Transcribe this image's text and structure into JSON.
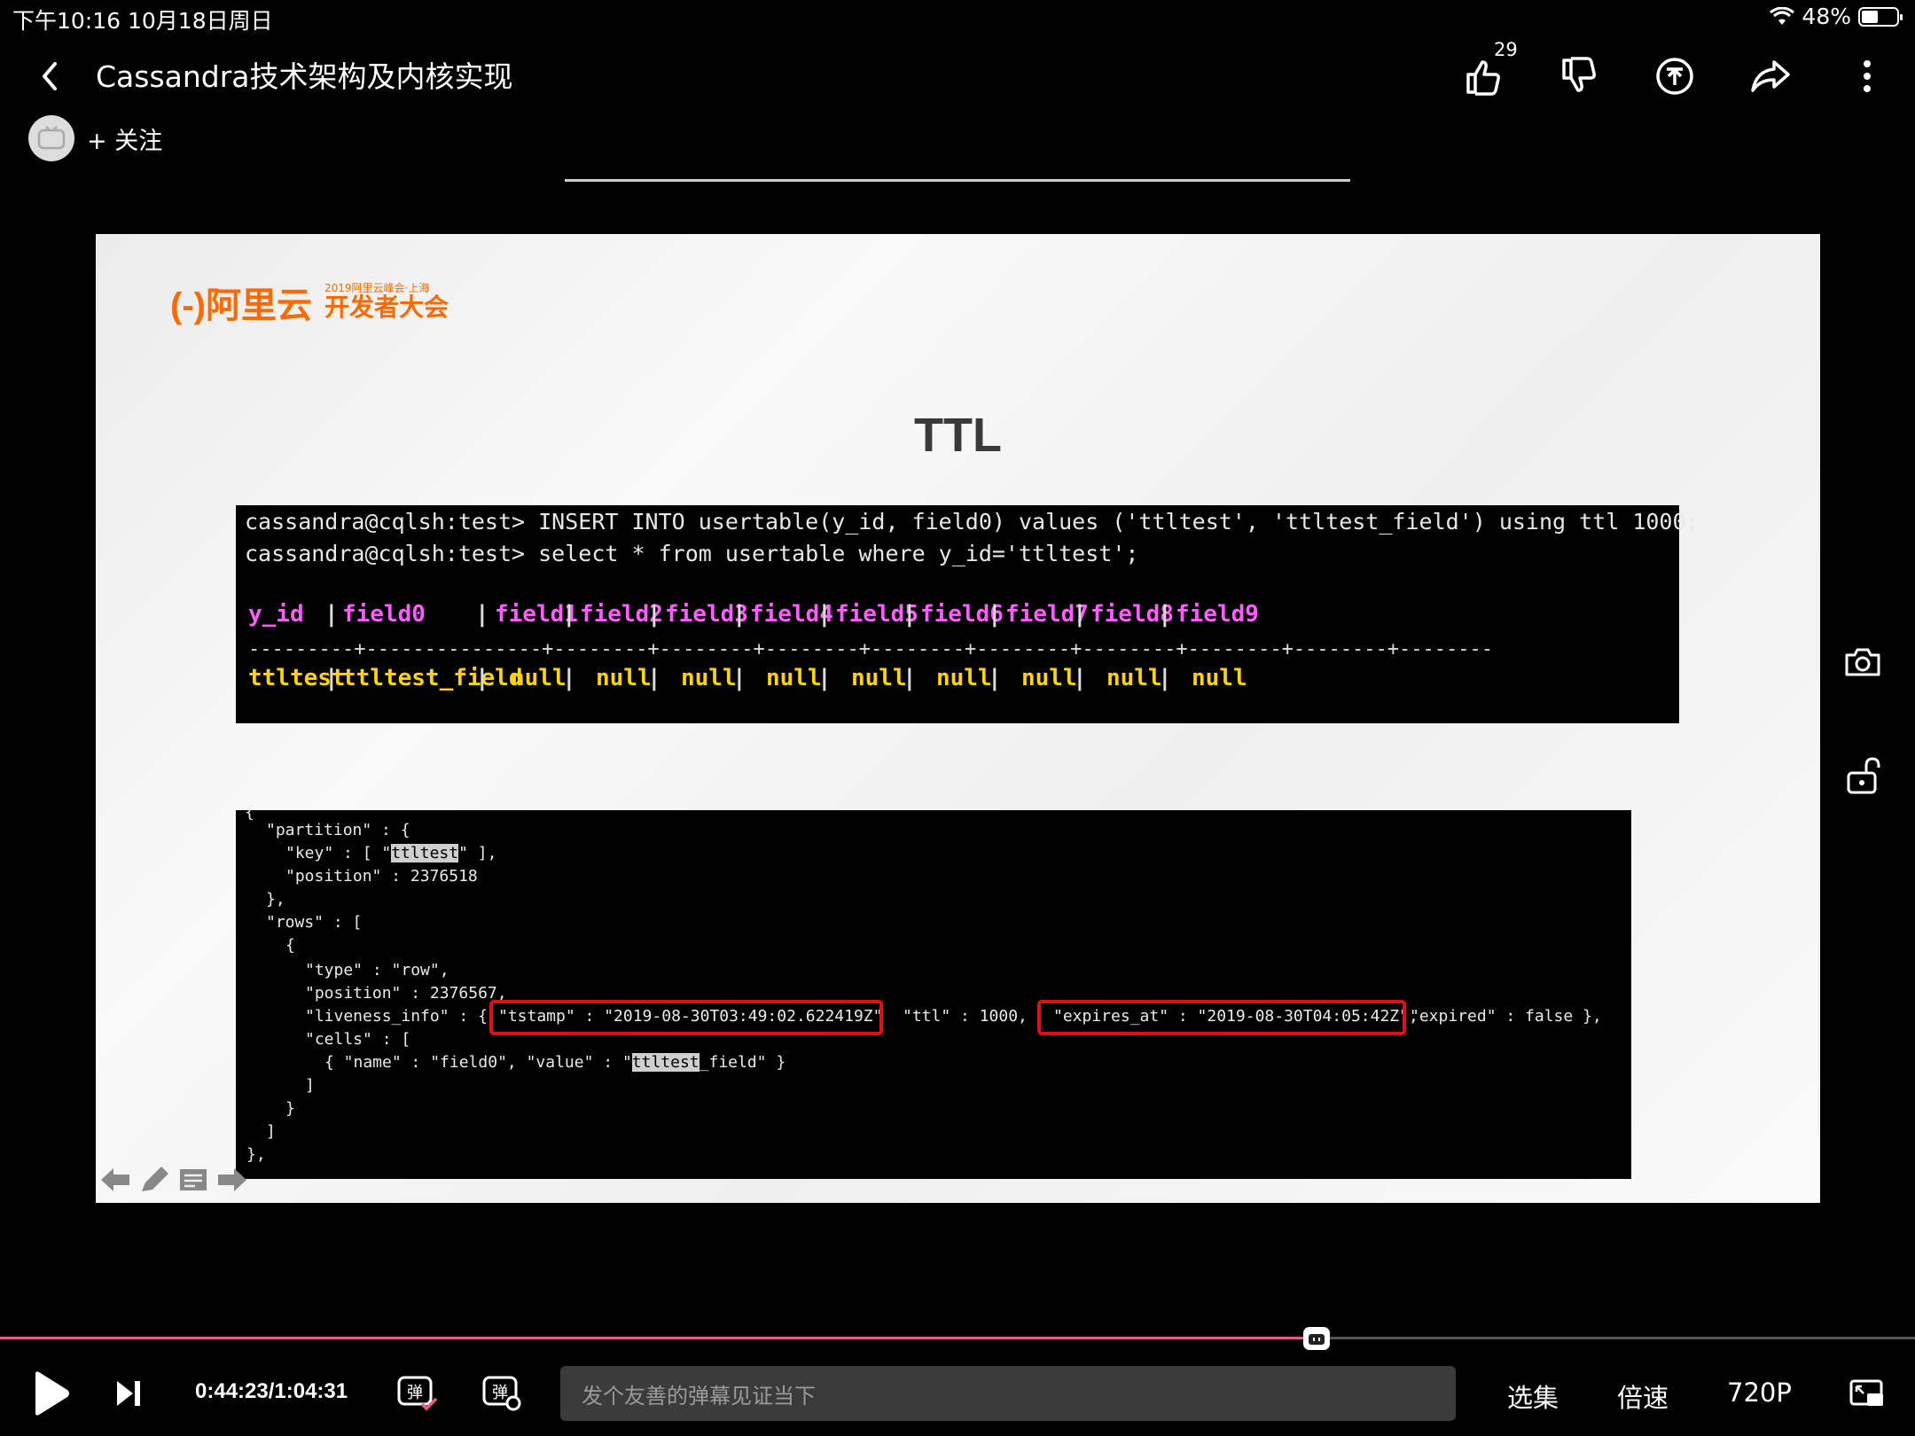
{
  "status_bar": {
    "time": "下午10:16  10月18日周日",
    "battery": "48%",
    "battery_level": 0.48
  },
  "header": {
    "title": "Cassandra技术架构及内核实现",
    "like_count": "29",
    "follow_label": "+ 关注"
  },
  "slide": {
    "logo_main": "(-)阿里云",
    "logo_sub_small": "2019阿里云峰会·上海",
    "logo_sub_big": "开发者大会",
    "title": "TTL",
    "terminal1": {
      "line1": "cassandra@cqlsh:test> INSERT INTO usertable(y_id, field0) values ('ttltest', 'ttltest_field') using ttl 1000;",
      "line2": "cassandra@cqlsh:test> select * from usertable where y_id='ttltest';",
      "headers": [
        "y_id",
        "field0",
        "field1",
        "field2",
        "field3",
        "field4",
        "field5",
        "field6",
        "field7",
        "field8",
        "field9"
      ],
      "separator": "---------+---------------+--------+--------+--------+--------+--------+--------+--------+--------+--------",
      "values": [
        "ttltest",
        "ttltest_field",
        "null",
        "null",
        "null",
        "null",
        "null",
        "null",
        "null",
        "null",
        "null"
      ]
    },
    "terminal2": {
      "l0": "{",
      "l1": "\"partition\" : {",
      "l2_pre": "\"key\" : [ \"",
      "l2_hl": "ttltest",
      "l2_post": "\" ],",
      "l3": "\"position\" : 2376518",
      "l4": "},",
      "l5": "\"rows\" : [",
      "l6": "{",
      "l7": "\"type\" : \"row\",",
      "l8": "\"position\" : 2376567,",
      "l9_pre": "\"liveness_info\" : { ",
      "l9_tstamp": "\"tstamp\" : \"2019-08-30T03:49:02.622419Z\"",
      "l9_ttl": "\"ttl\" : 1000, ",
      "l9_expires": "\"expires_at\" : \"2019-08-30T04:05:42Z\",",
      "l9_post": "\"expired\" : false },",
      "l10": "\"cells\" : [",
      "l11_pre": "{ \"name\" : \"field0\", \"value\" : \"",
      "l11_hl": "ttltest",
      "l11_post": "_field\" }",
      "l12": "]",
      "l13": "}",
      "l14": "]",
      "l15": "},"
    }
  },
  "player": {
    "time": "0:44:23/1:04:31",
    "progress": 0.6873,
    "danmaku_placeholder": "发个友善的弹幕见证当下",
    "select_episode": "选集",
    "speed": "倍速",
    "quality": "720P"
  },
  "colors": {
    "accent": "#e85d7d",
    "logo": "#ff6a00",
    "header_cols": "#ff5cff",
    "value_cols": "#ffd400",
    "redbox": "#e01010"
  }
}
